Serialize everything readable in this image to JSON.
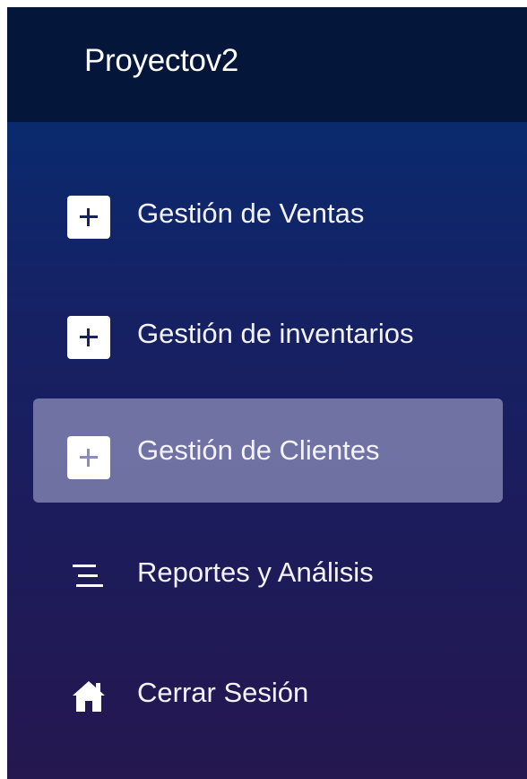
{
  "app": {
    "brand": "Proyectov2"
  },
  "sidebar": {
    "items": [
      {
        "label": "Gestión de Ventas",
        "icon": "plus-square-icon",
        "active": false
      },
      {
        "label": "Gestión de inventarios",
        "icon": "plus-square-icon",
        "active": false
      },
      {
        "label": "Gestión de Clientes",
        "icon": "plus-square-icon",
        "active": true
      },
      {
        "label": "Reportes y Análisis",
        "icon": "lines-icon",
        "active": false
      },
      {
        "label": "Cerrar Sesión",
        "icon": "home-icon",
        "active": false
      }
    ]
  },
  "colors": {
    "header": "#04163a",
    "active_background": "#9a9ac6",
    "text": "#ffffff"
  }
}
